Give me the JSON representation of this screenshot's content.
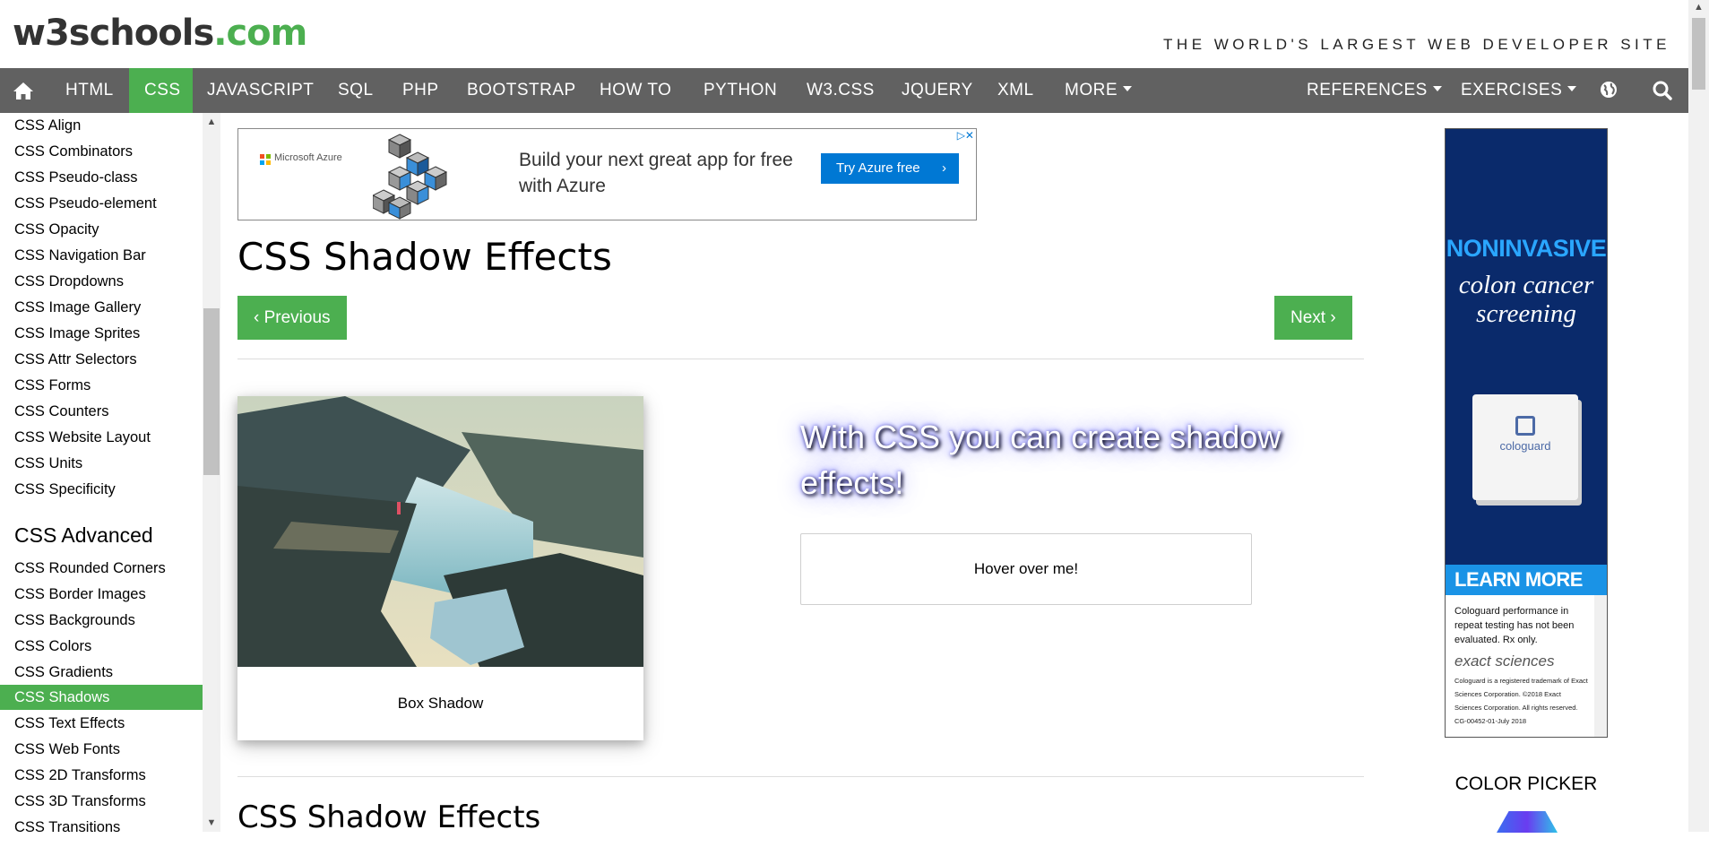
{
  "header": {
    "logo_main": "w3schools",
    "logo_suffix": ".com",
    "tagline": "THE WORLD'S LARGEST WEB DEVELOPER SITE"
  },
  "nav": {
    "items": [
      "HTML",
      "CSS",
      "JAVASCRIPT",
      "SQL",
      "PHP",
      "BOOTSTRAP",
      "HOW TO",
      "PYTHON",
      "W3.CSS",
      "JQUERY",
      "XML",
      "MORE"
    ],
    "active": "CSS",
    "right_items": [
      "REFERENCES",
      "EXERCISES"
    ]
  },
  "sidebar": {
    "links_top": [
      "CSS Align",
      "CSS Combinators",
      "CSS Pseudo-class",
      "CSS Pseudo-element",
      "CSS Opacity",
      "CSS Navigation Bar",
      "CSS Dropdowns",
      "CSS Image Gallery",
      "CSS Image Sprites",
      "CSS Attr Selectors",
      "CSS Forms",
      "CSS Counters",
      "CSS Website Layout",
      "CSS Units",
      "CSS Specificity"
    ],
    "heading": "CSS Advanced",
    "links_advanced": [
      "CSS Rounded Corners",
      "CSS Border Images",
      "CSS Backgrounds",
      "CSS Colors",
      "CSS Gradients",
      "CSS Shadows",
      "CSS Text Effects",
      "CSS Web Fonts",
      "CSS 2D Transforms",
      "CSS 3D Transforms",
      "CSS Transitions"
    ],
    "active": "CSS Shadows"
  },
  "ad_top": {
    "brand": "Microsoft Azure",
    "headline": "Build your next great app for free with Azure",
    "button": "Try Azure free",
    "colors": [
      "#f25022",
      "#7fba00",
      "#00a4ef",
      "#ffb900"
    ]
  },
  "main": {
    "title": "CSS Shadow Effects",
    "prev_label": "Previous",
    "next_label": "Next",
    "card_caption": "Box Shadow",
    "shadow_text": "With CSS you can create shadow effects!",
    "hover_text": "Hover over me!",
    "sub_title": "CSS Shadow Effects"
  },
  "ad_right": {
    "headline": "NONINVASIVE",
    "subline": "colon cancer screening",
    "product": "cologuard",
    "cta": "LEARN MORE",
    "fine_print": "Cologuard performance in repeat testing has not been evaluated. Rx only.",
    "company": "exact sciences",
    "legal": "Cologuard is a registered trademark of Exact Sciences Corporation. ©2018 Exact Sciences Corporation. All rights reserved. CG-00452-01-July 2018"
  },
  "color_picker": {
    "label": "COLOR PICKER"
  }
}
